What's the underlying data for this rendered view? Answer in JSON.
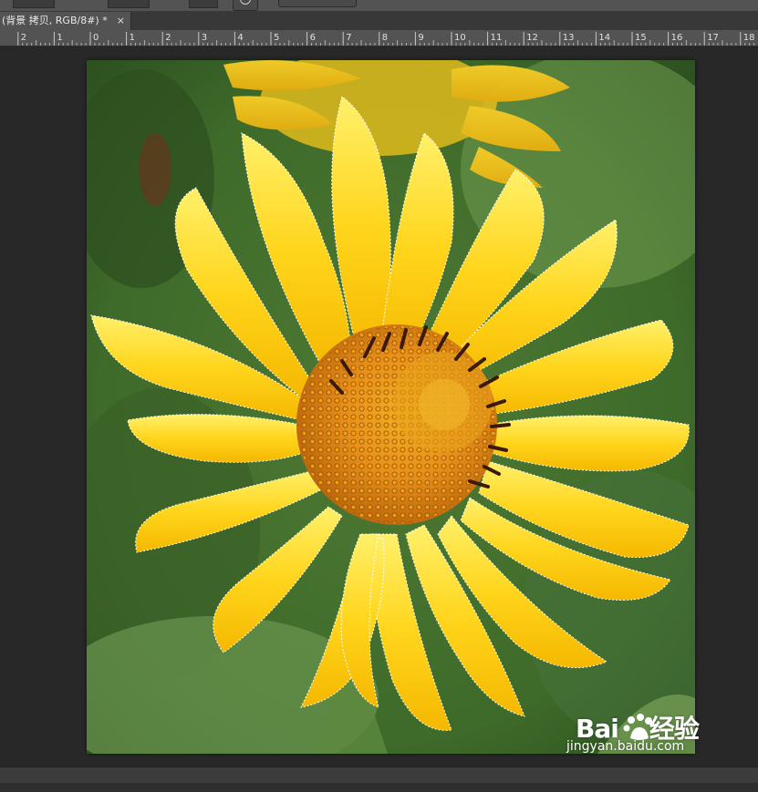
{
  "document_tab": {
    "title": "(背景 拷贝, RGB/8#) *",
    "close_glyph": "×"
  },
  "ruler": {
    "labels": [
      "2",
      "1",
      "0",
      "1",
      "2",
      "3",
      "4",
      "5",
      "6",
      "7",
      "8",
      "9",
      "10",
      "11",
      "12",
      "13",
      "14",
      "15",
      "16",
      "17",
      "18"
    ]
  },
  "watermark": {
    "brand_left": "Bai",
    "brand_right": "经验",
    "site": "jingyan.baidu.com"
  },
  "colors": {
    "petal": "#ffd21a",
    "petal_light": "#ffe94a",
    "center": "#e08a10",
    "stamen": "#3a1a08",
    "leaf": "#5e8a3c",
    "background_dark": "#282828",
    "panel": "#535353"
  },
  "icons": {
    "close": "close-icon",
    "brush": "brush-target-icon"
  }
}
